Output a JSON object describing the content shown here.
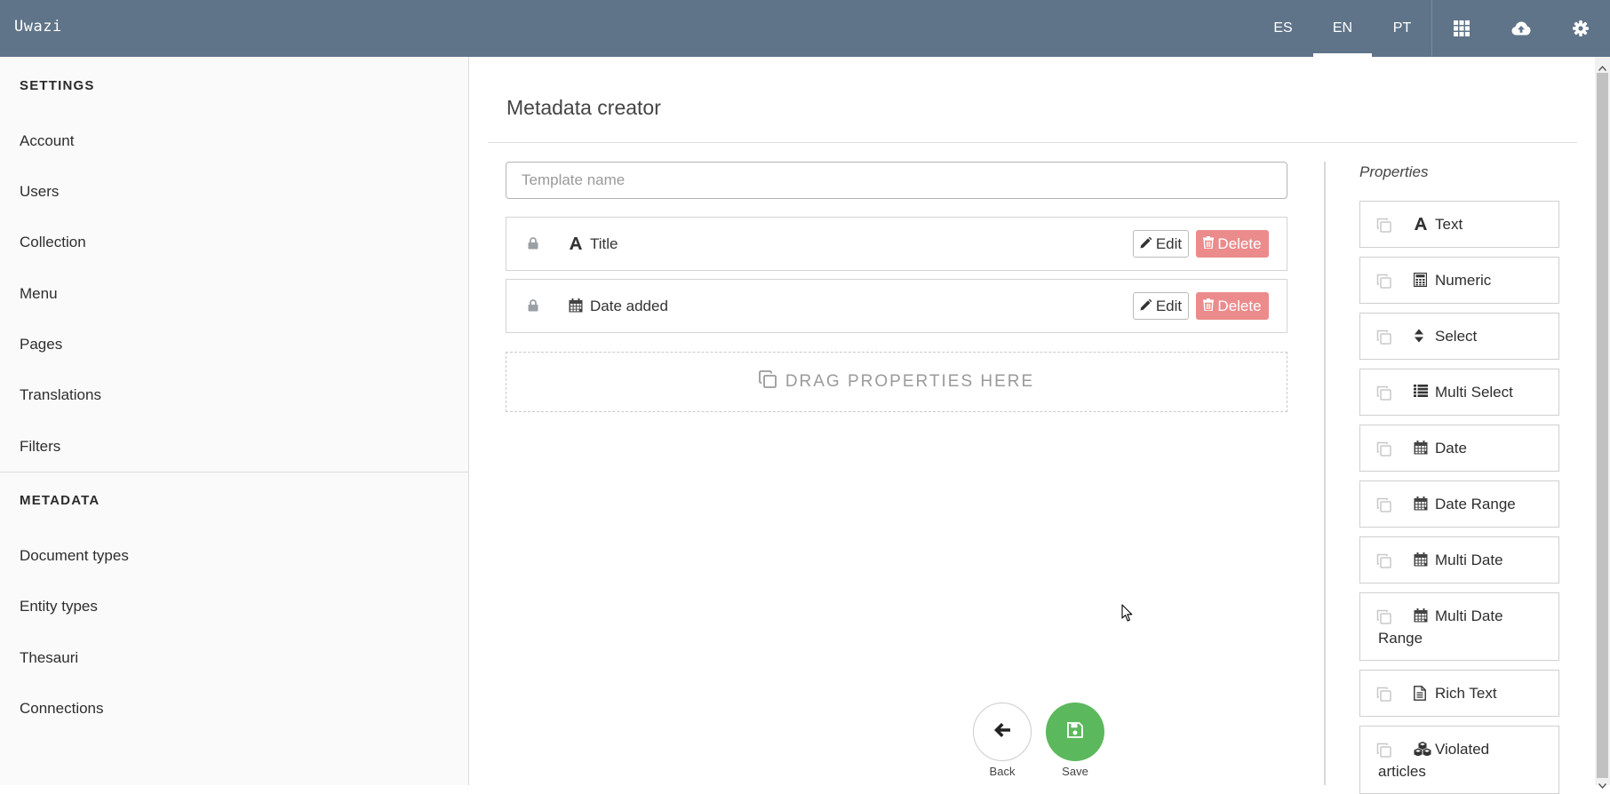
{
  "app": {
    "brand": "Uwazi"
  },
  "header": {
    "languages": [
      {
        "label": "ES",
        "active": false
      },
      {
        "label": "EN",
        "active": true
      },
      {
        "label": "PT",
        "active": false
      }
    ],
    "icons": [
      "grid-icon",
      "cloud-upload-icon",
      "gear-icon"
    ]
  },
  "sidebar": {
    "settings_heading": "SETTINGS",
    "settings_items": [
      {
        "label": "Account"
      },
      {
        "label": "Users"
      },
      {
        "label": "Collection"
      },
      {
        "label": "Menu"
      },
      {
        "label": "Pages"
      },
      {
        "label": "Translations"
      },
      {
        "label": "Filters"
      }
    ],
    "metadata_heading": "METADATA",
    "metadata_items": [
      {
        "label": "Document types"
      },
      {
        "label": "Entity types"
      },
      {
        "label": "Thesauri"
      },
      {
        "label": "Connections"
      }
    ]
  },
  "main": {
    "title": "Metadata creator",
    "template_name": {
      "value": "",
      "placeholder": "Template name"
    },
    "properties": [
      {
        "label": "Title",
        "icon": "font-icon",
        "locked": true
      },
      {
        "label": "Date added",
        "icon": "calendar-icon",
        "locked": true
      }
    ],
    "edit_label": "Edit",
    "delete_label": "Delete",
    "dropzone_label": "DRAG PROPERTIES HERE",
    "back_label": "Back",
    "save_label": "Save"
  },
  "properties_panel": {
    "heading": "Properties",
    "items": [
      {
        "label": "Text",
        "icon": "font-icon"
      },
      {
        "label": "Numeric",
        "icon": "calculator-icon"
      },
      {
        "label": "Select",
        "icon": "sort-icon"
      },
      {
        "label": "Multi Select",
        "icon": "list-icon"
      },
      {
        "label": "Date",
        "icon": "calendar-icon"
      },
      {
        "label": "Date Range",
        "icon": "calendar-icon"
      },
      {
        "label": "Multi Date",
        "icon": "calendar-icon"
      },
      {
        "label": "Multi Date",
        "label_line2": "Range",
        "icon": "calendar-icon"
      },
      {
        "label": "Rich Text",
        "icon": "file-text-icon"
      },
      {
        "label": "Violated",
        "label_line2": "articles",
        "icon": "cubes-icon"
      }
    ]
  },
  "colors": {
    "topbar": "#5f7489",
    "delete": "#eb8b8c",
    "save": "#5cb85c"
  }
}
